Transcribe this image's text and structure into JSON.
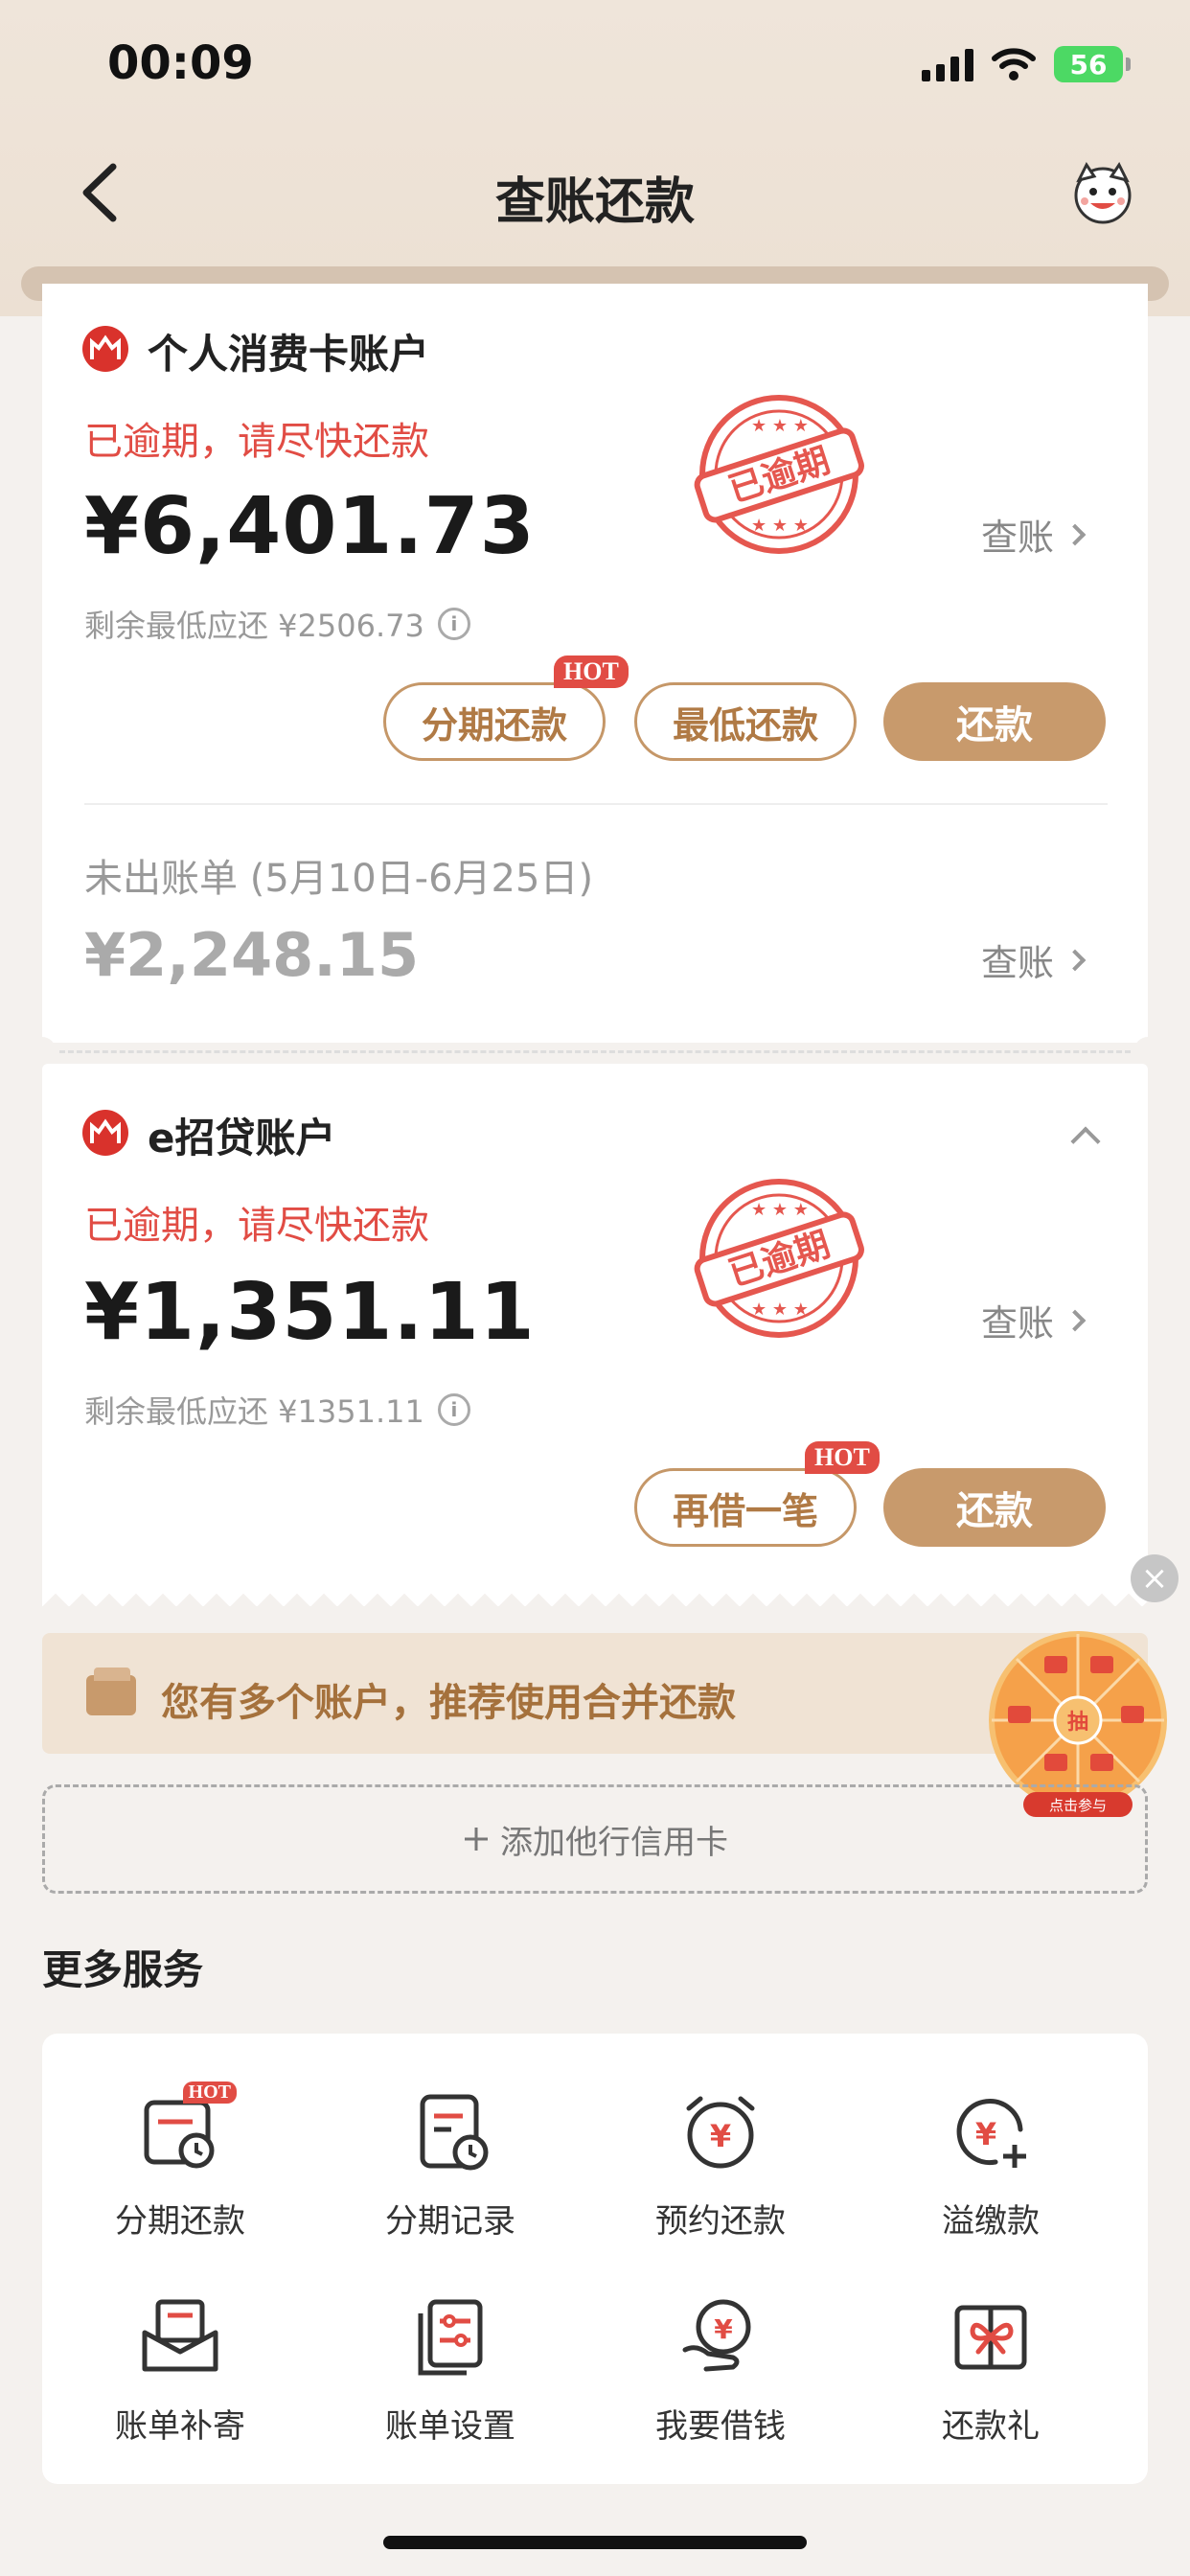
{
  "status_bar": {
    "time": "00:09",
    "battery": "56"
  },
  "nav": {
    "title": "查账还款"
  },
  "accounts": [
    {
      "name": "个人消费卡账户",
      "overdue_text": "已逾期，请尽快还款",
      "stamp_text": "已逾期",
      "amount": "¥6,401.73",
      "min_due": "剩余最低应还 ¥2506.73",
      "view_label": "查账",
      "buttons": {
        "installment": "分期还款",
        "minimum": "最低还款",
        "repay": "还款"
      },
      "hot": "HOT",
      "unbilled_title": "未出账单 (5月10日-6月25日)",
      "unbilled_amount": "¥2,248.15",
      "unbilled_view": "查账"
    },
    {
      "name": "e招贷账户",
      "overdue_text": "已逾期，请尽快还款",
      "stamp_text": "已逾期",
      "amount": "¥1,351.11",
      "min_due": "剩余最低应还 ¥1351.11",
      "view_label": "查账",
      "buttons": {
        "borrow_again": "再借一笔",
        "repay": "还款"
      },
      "hot": "HOT"
    }
  ],
  "merge_banner": {
    "text": "您有多个账户，推荐使用合并还款"
  },
  "add_card": {
    "text": "添加他行信用卡",
    "icon": "plus-icon"
  },
  "wheel_promo": {
    "label": "点击参与",
    "center": "抽"
  },
  "more_services": {
    "title": "更多服务",
    "items": [
      {
        "label": "分期还款",
        "icon": "installment-icon",
        "hot": "HOT"
      },
      {
        "label": "分期记录",
        "icon": "installment-record-icon"
      },
      {
        "label": "预约还款",
        "icon": "alarm-yen-icon"
      },
      {
        "label": "溢缴款",
        "icon": "yen-plus-icon"
      },
      {
        "label": "账单补寄",
        "icon": "mail-icon"
      },
      {
        "label": "账单设置",
        "icon": "bill-settings-icon"
      },
      {
        "label": "我要借钱",
        "icon": "hand-yen-icon"
      },
      {
        "label": "还款礼",
        "icon": "gift-icon"
      }
    ]
  },
  "colors": {
    "accent": "#c89a6c",
    "overdue": "#e14c44",
    "brand": "#d9322c"
  }
}
